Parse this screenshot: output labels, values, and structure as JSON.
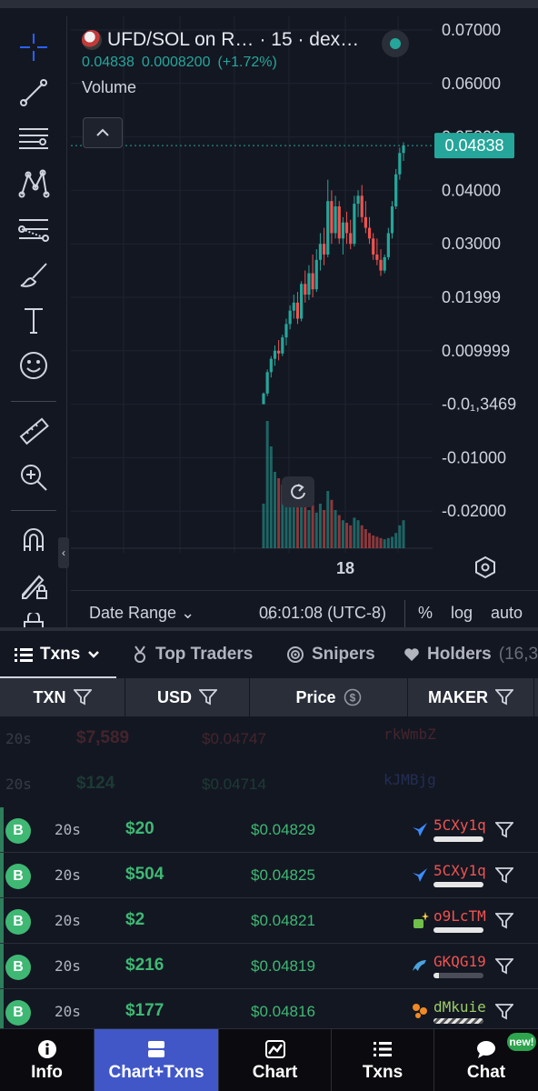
{
  "chart": {
    "pair_label": "UFD/SOL on R…",
    "interval_label": "· 15 · dex…",
    "last_price": "0.04838",
    "change_abs": "0.0008200",
    "change_pct": "(+1.72%)",
    "volume_label": "Volume",
    "current_price_tag": "0.04838",
    "x_tick_label": "18",
    "accent_up": "#26a69a",
    "accent_down": "#ef5350"
  },
  "chart_data": {
    "type": "candlestick",
    "y_axis_labels": [
      "0.07000",
      "0.06000",
      "0.05000",
      "0.04000",
      "0.03000",
      "0.01999",
      "0.009999",
      "-0.0₁,3469",
      "-0.01000",
      "-0.02000"
    ],
    "x_axis_labels": [
      "18"
    ],
    "last_price": 0.04838,
    "ylim": [
      -0.025,
      0.072
    ],
    "candles": [
      [
        0.0,
        0.0022,
        0.0,
        0.002
      ],
      [
        0.002,
        0.0065,
        0.0015,
        0.006
      ],
      [
        0.006,
        0.009,
        0.005,
        0.0085
      ],
      [
        0.0085,
        0.011,
        0.0072,
        0.01
      ],
      [
        0.01,
        0.012,
        0.0082,
        0.0095
      ],
      [
        0.0095,
        0.013,
        0.009,
        0.0125
      ],
      [
        0.0125,
        0.016,
        0.011,
        0.015
      ],
      [
        0.015,
        0.0185,
        0.014,
        0.0175
      ],
      [
        0.0175,
        0.0205,
        0.016,
        0.019
      ],
      [
        0.019,
        0.021,
        0.015,
        0.016
      ],
      [
        0.016,
        0.023,
        0.0155,
        0.0225
      ],
      [
        0.0225,
        0.025,
        0.019,
        0.0205
      ],
      [
        0.0205,
        0.026,
        0.0195,
        0.0245
      ],
      [
        0.0245,
        0.028,
        0.02,
        0.0215
      ],
      [
        0.0215,
        0.029,
        0.021,
        0.027
      ],
      [
        0.027,
        0.032,
        0.025,
        0.03
      ],
      [
        0.03,
        0.033,
        0.026,
        0.028
      ],
      [
        0.028,
        0.042,
        0.0275,
        0.038
      ],
      [
        0.038,
        0.04,
        0.03,
        0.032
      ],
      [
        0.032,
        0.039,
        0.031,
        0.037
      ],
      [
        0.037,
        0.038,
        0.03,
        0.031
      ],
      [
        0.031,
        0.035,
        0.028,
        0.034
      ],
      [
        0.034,
        0.036,
        0.03,
        0.032
      ],
      [
        0.032,
        0.0345,
        0.029,
        0.03
      ],
      [
        0.03,
        0.039,
        0.0295,
        0.0375
      ],
      [
        0.0375,
        0.04,
        0.035,
        0.039
      ],
      [
        0.039,
        0.041,
        0.034,
        0.035
      ],
      [
        0.035,
        0.038,
        0.032,
        0.033
      ],
      [
        0.033,
        0.035,
        0.03,
        0.031
      ],
      [
        0.031,
        0.032,
        0.027,
        0.028
      ],
      [
        0.028,
        0.031,
        0.026,
        0.027
      ],
      [
        0.027,
        0.029,
        0.024,
        0.025
      ],
      [
        0.025,
        0.028,
        0.0245,
        0.0275
      ],
      [
        0.0275,
        0.033,
        0.027,
        0.032
      ],
      [
        0.032,
        0.038,
        0.031,
        0.037
      ],
      [
        0.037,
        0.044,
        0.0365,
        0.043
      ],
      [
        0.043,
        0.048,
        0.042,
        0.047
      ],
      [
        0.047,
        0.049,
        0.0455,
        0.0484
      ]
    ],
    "volumes": [
      0.35,
      1.0,
      0.8,
      0.6,
      0.55,
      0.5,
      0.45,
      0.42,
      0.38,
      0.4,
      0.36,
      0.33,
      0.3,
      0.34,
      0.28,
      0.35,
      0.3,
      0.45,
      0.38,
      0.3,
      0.26,
      0.22,
      0.2,
      0.18,
      0.24,
      0.22,
      0.18,
      0.15,
      0.12,
      0.1,
      0.09,
      0.08,
      0.07,
      0.08,
      0.09,
      0.12,
      0.18,
      0.22
    ]
  },
  "toolbar": {
    "icons": [
      "crosshair-icon",
      "trend-line-icon",
      "horizontal-lines-icon",
      "pattern-icon",
      "fib-icon",
      "brush-icon",
      "text-icon",
      "emoji-icon",
      "ruler-icon",
      "zoom-in-icon",
      "magnet-icon",
      "lock-drawing-icon",
      "lock-icon"
    ]
  },
  "date_bar": {
    "date_range": "Date Range ⌄",
    "time": "06:01:08 (UTC-8)",
    "percent": "%",
    "log": "log",
    "auto": "auto"
  },
  "tabs": [
    {
      "label": "Txns",
      "icon": "list-icon",
      "active": true
    },
    {
      "label": "Top Traders",
      "icon": "medal-icon"
    },
    {
      "label": "Snipers",
      "icon": "target-icon"
    },
    {
      "label": "Holders",
      "suffix": "(16,3",
      "icon": "heart-icon"
    }
  ],
  "table": {
    "headers": [
      "TXN",
      "USD",
      "Price",
      "MAKER"
    ],
    "faded_rows": [
      {
        "age": "20s",
        "usd": "$7,589",
        "price": "$0.04747",
        "maker": "rkWmbZ",
        "usd_color": "#ef5350"
      },
      {
        "age": "20s",
        "usd": "$124",
        "price": "$0.04714",
        "maker": "kJMBjg",
        "usd_color": "#3fb874"
      }
    ],
    "rows": [
      {
        "type": "B",
        "age": "20s",
        "usd": "$20",
        "price": "$0.04829",
        "maker": "5CXy1q",
        "maker_color": "#ef5350",
        "maker_icon": "bird-icon",
        "bar": 1.0
      },
      {
        "type": "B",
        "age": "20s",
        "usd": "$504",
        "price": "$0.04825",
        "maker": "5CXy1q",
        "maker_color": "#ef5350",
        "maker_icon": "bird-icon",
        "bar": 1.0
      },
      {
        "type": "B",
        "age": "20s",
        "usd": "$2",
        "price": "$0.04821",
        "maker": "o9LcTM",
        "maker_color": "#ef5350",
        "maker_icon": "sparkle-bag-icon",
        "bar": 1.0
      },
      {
        "type": "B",
        "age": "20s",
        "usd": "$216",
        "price": "$0.04819",
        "maker": "GKQG19",
        "maker_color": "#ef5350",
        "maker_icon": "dolphin-icon",
        "bar": 0.1
      },
      {
        "type": "B",
        "age": "20s",
        "usd": "$177",
        "price": "$0.04816",
        "maker": "dMkuie",
        "maker_color": "#9ccc65",
        "maker_icon": "orange-shrimp-icon",
        "bar": 1.0
      }
    ]
  },
  "bottom_nav": [
    {
      "label": "Info",
      "icon": "info-icon"
    },
    {
      "label": "Chart+Txns",
      "icon": "chart-txns-icon",
      "active": true
    },
    {
      "label": "Chart",
      "icon": "chart-icon"
    },
    {
      "label": "Txns",
      "icon": "txns-icon"
    },
    {
      "label": "Chat",
      "icon": "chat-icon",
      "badge": "new!"
    }
  ]
}
